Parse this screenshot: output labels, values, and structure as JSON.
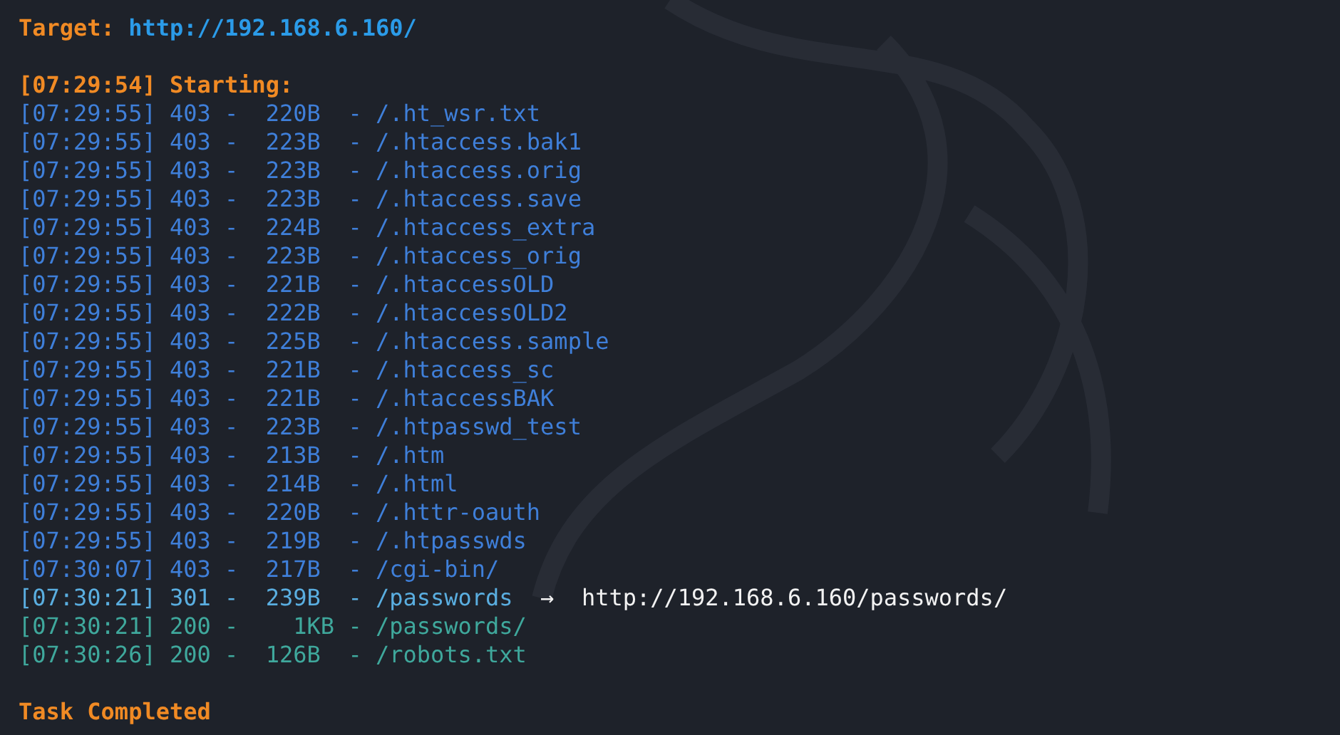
{
  "target": {
    "label": "Target:",
    "url": "http://192.168.6.160/"
  },
  "start": {
    "time": "[07:29:54]",
    "label": "Starting:"
  },
  "rows": [
    {
      "text": "[07:29:55] 403 -  220B  - /.ht_wsr.txt",
      "color": "#3f7fd9"
    },
    {
      "text": "[07:29:55] 403 -  223B  - /.htaccess.bak1",
      "color": "#3f7fd9"
    },
    {
      "text": "[07:29:55] 403 -  223B  - /.htaccess.orig",
      "color": "#3f7fd9"
    },
    {
      "text": "[07:29:55] 403 -  223B  - /.htaccess.save",
      "color": "#3f7fd9"
    },
    {
      "text": "[07:29:55] 403 -  224B  - /.htaccess_extra",
      "color": "#3f7fd9"
    },
    {
      "text": "[07:29:55] 403 -  223B  - /.htaccess_orig",
      "color": "#3f7fd9"
    },
    {
      "text": "[07:29:55] 403 -  221B  - /.htaccessOLD",
      "color": "#3f7fd9"
    },
    {
      "text": "[07:29:55] 403 -  222B  - /.htaccessOLD2",
      "color": "#3f7fd9"
    },
    {
      "text": "[07:29:55] 403 -  225B  - /.htaccess.sample",
      "color": "#3f7fd9"
    },
    {
      "text": "[07:29:55] 403 -  221B  - /.htaccess_sc",
      "color": "#3f7fd9"
    },
    {
      "text": "[07:29:55] 403 -  221B  - /.htaccessBAK",
      "color": "#3f7fd9"
    },
    {
      "text": "[07:29:55] 403 -  223B  - /.htpasswd_test",
      "color": "#3f7fd9"
    },
    {
      "text": "[07:29:55] 403 -  213B  - /.htm",
      "color": "#3f7fd9"
    },
    {
      "text": "[07:29:55] 403 -  214B  - /.html",
      "color": "#3f7fd9"
    },
    {
      "text": "[07:29:55] 403 -  220B  - /.httr-oauth",
      "color": "#3f7fd9"
    },
    {
      "text": "[07:29:55] 403 -  219B  - /.htpasswds",
      "color": "#3f7fd9"
    },
    {
      "text": "[07:30:07] 403 -  217B  - /cgi-bin/",
      "color": "#3f7fd9"
    },
    {
      "text": "[07:30:21] 301 -  239B  - /passwords",
      "color": "#5aaee0",
      "redirect": {
        "arrow": "→",
        "url": "http://192.168.6.160/passwords/"
      }
    },
    {
      "text": "[07:30:21] 200 -    1KB - /passwords/",
      "color": "#3fa89c"
    },
    {
      "text": "[07:30:26] 200 -  126B  - /robots.txt",
      "color": "#3fa89c"
    }
  ],
  "footer": "Task Completed"
}
